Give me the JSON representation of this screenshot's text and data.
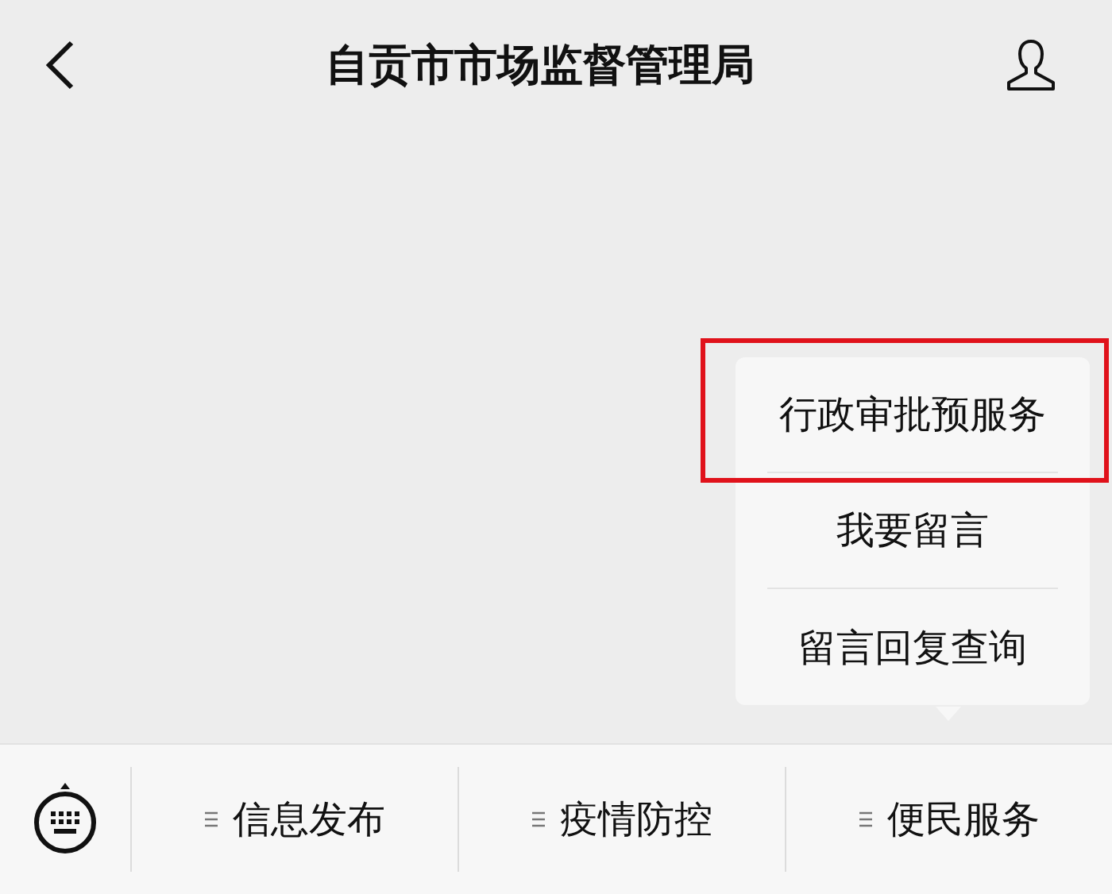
{
  "header": {
    "title": "自贡市市场监督管理局"
  },
  "menu_popup": {
    "items": [
      {
        "label": "行政审批预服务",
        "highlighted": true
      },
      {
        "label": "我要留言",
        "highlighted": false
      },
      {
        "label": "留言回复查询",
        "highlighted": false
      }
    ]
  },
  "bottom_menu": {
    "items": [
      {
        "label": "信息发布"
      },
      {
        "label": "疫情防控"
      },
      {
        "label": "便民服务"
      }
    ]
  }
}
